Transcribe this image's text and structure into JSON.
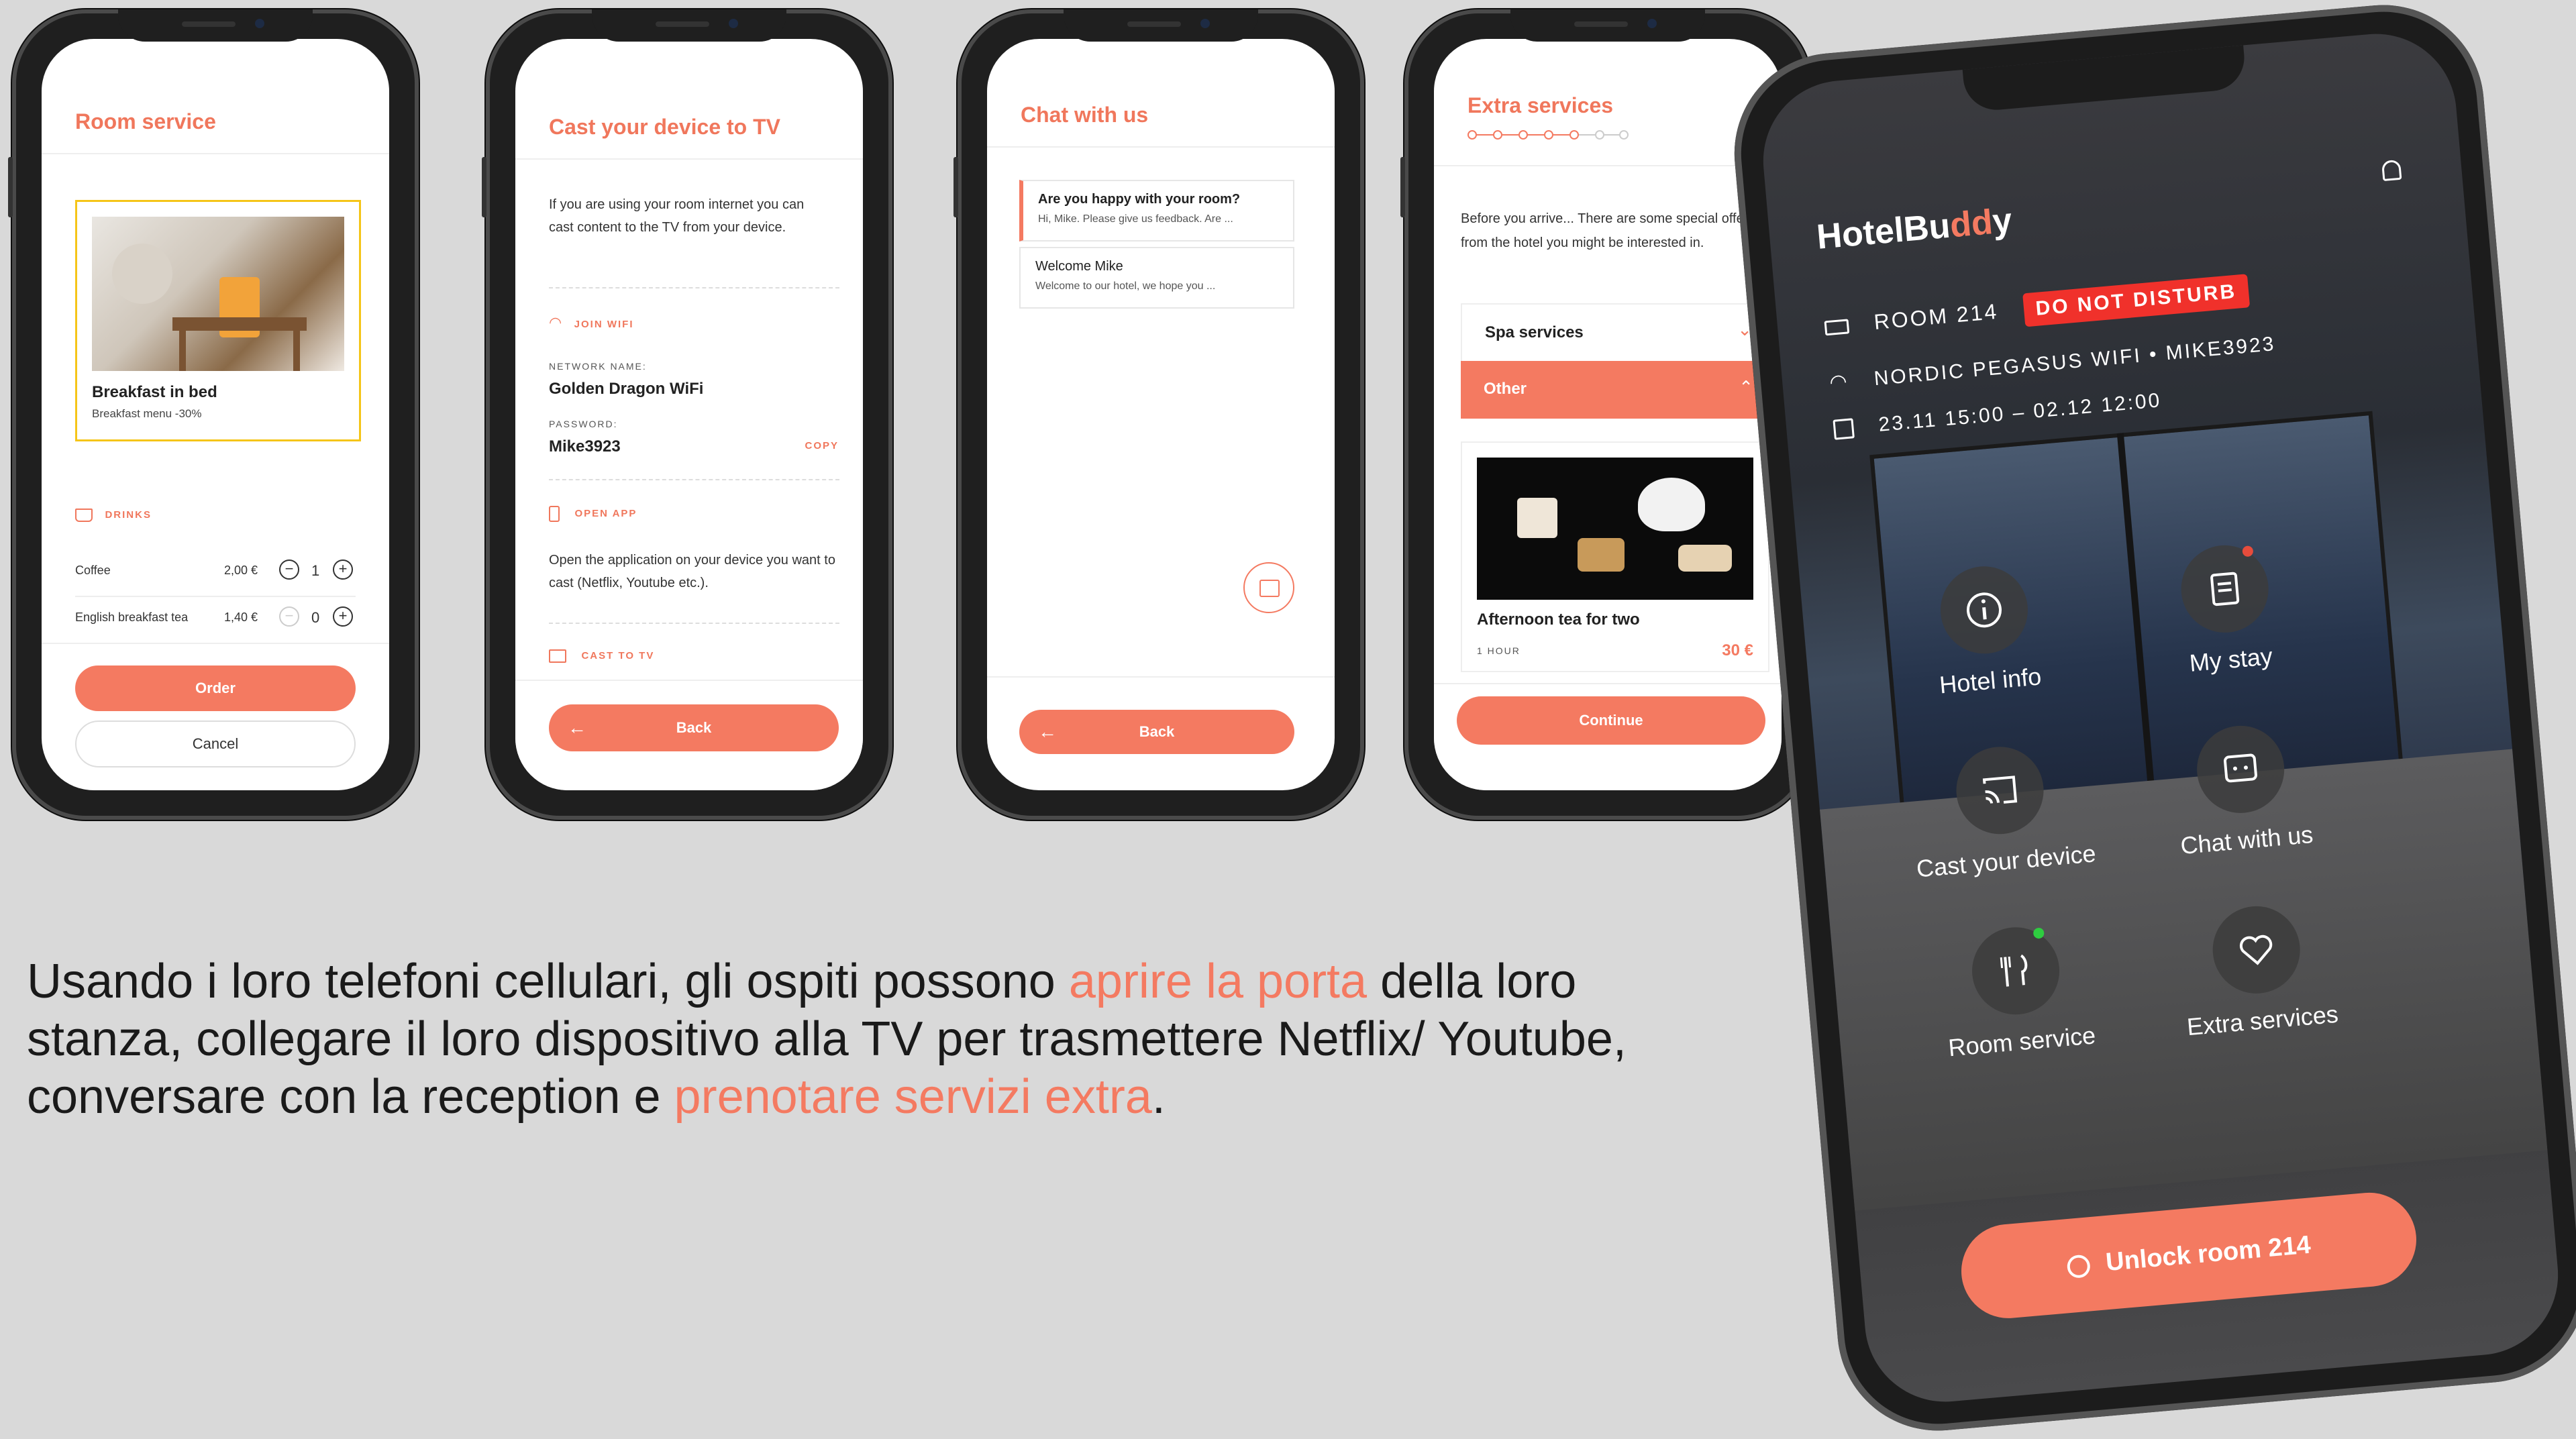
{
  "room_service": {
    "title": "Room service",
    "card_title": "Breakfast in bed",
    "card_sub": "Breakfast menu -30%",
    "section": "DRINKS",
    "items": [
      {
        "name": "Coffee",
        "price": "2,00 €",
        "qty": "1"
      },
      {
        "name": "English breakfast tea",
        "price": "1,40 €",
        "qty": "0"
      }
    ],
    "order": "Order",
    "cancel": "Cancel"
  },
  "cast": {
    "title": "Cast your device to TV",
    "intro": "If you are using your room internet you can cast content to the TV from your device.",
    "join_wifi": "JOIN WIFI",
    "network_label": "NETWORK NAME:",
    "network": "Golden Dragon WiFi",
    "password_label": "PASSWORD:",
    "password": "Mike3923",
    "copy": "COPY",
    "open_app": "OPEN APP",
    "open_app_text": "Open the application on your device you want to cast (Netflix, Youtube etc.).",
    "cast_tv": "CAST TO TV",
    "back": "Back"
  },
  "chat": {
    "title": "Chat with us",
    "messages": [
      {
        "title": "Are you happy with your room?",
        "preview": "Hi, Mike. Please give us feedback. Are ..."
      },
      {
        "title": "Welcome Mike",
        "preview": "Welcome to our hotel, we hope you ..."
      }
    ],
    "back": "Back"
  },
  "extra": {
    "title": "Extra services",
    "intro": "Before you arrive... There are some special offers from the hotel you might be interested in.",
    "spa": "Spa services",
    "other": "Other",
    "offer_title": "Afternoon tea for two",
    "offer_duration": "1 HOUR",
    "offer_price": "30 €",
    "continue": "Continue",
    "steps_total": 7,
    "steps_done": 5
  },
  "home": {
    "logo_a": "HotelBu",
    "logo_b": "dd",
    "logo_c": "y",
    "room": "ROOM 214",
    "dnd": "DO NOT DISTURB",
    "wifi": "NORDIC PEGASUS WIFI • MIKE3923",
    "dates": "23.11 15:00 – 02.12 12:00",
    "menu": [
      "Hotel info",
      "My stay",
      "Cast your device",
      "Chat with us",
      "Room service",
      "Extra services"
    ],
    "unlock": "Unlock room 214"
  },
  "caption": {
    "p1": "Usando i loro telefoni cellulari, gli ospiti possono ",
    "h1": "aprire la porta",
    "p2": " della loro stanza, collegare il loro dispositivo alla TV per trasmettere Netflix/ Youtube, conversare con la reception e ",
    "h2": "prenotare servizi extra",
    "p3": "."
  },
  "colors": {
    "accent": "#f47a61",
    "dnd_red": "#f0312b",
    "status_green": "#2ecc40",
    "status_red": "#e74c3c"
  }
}
